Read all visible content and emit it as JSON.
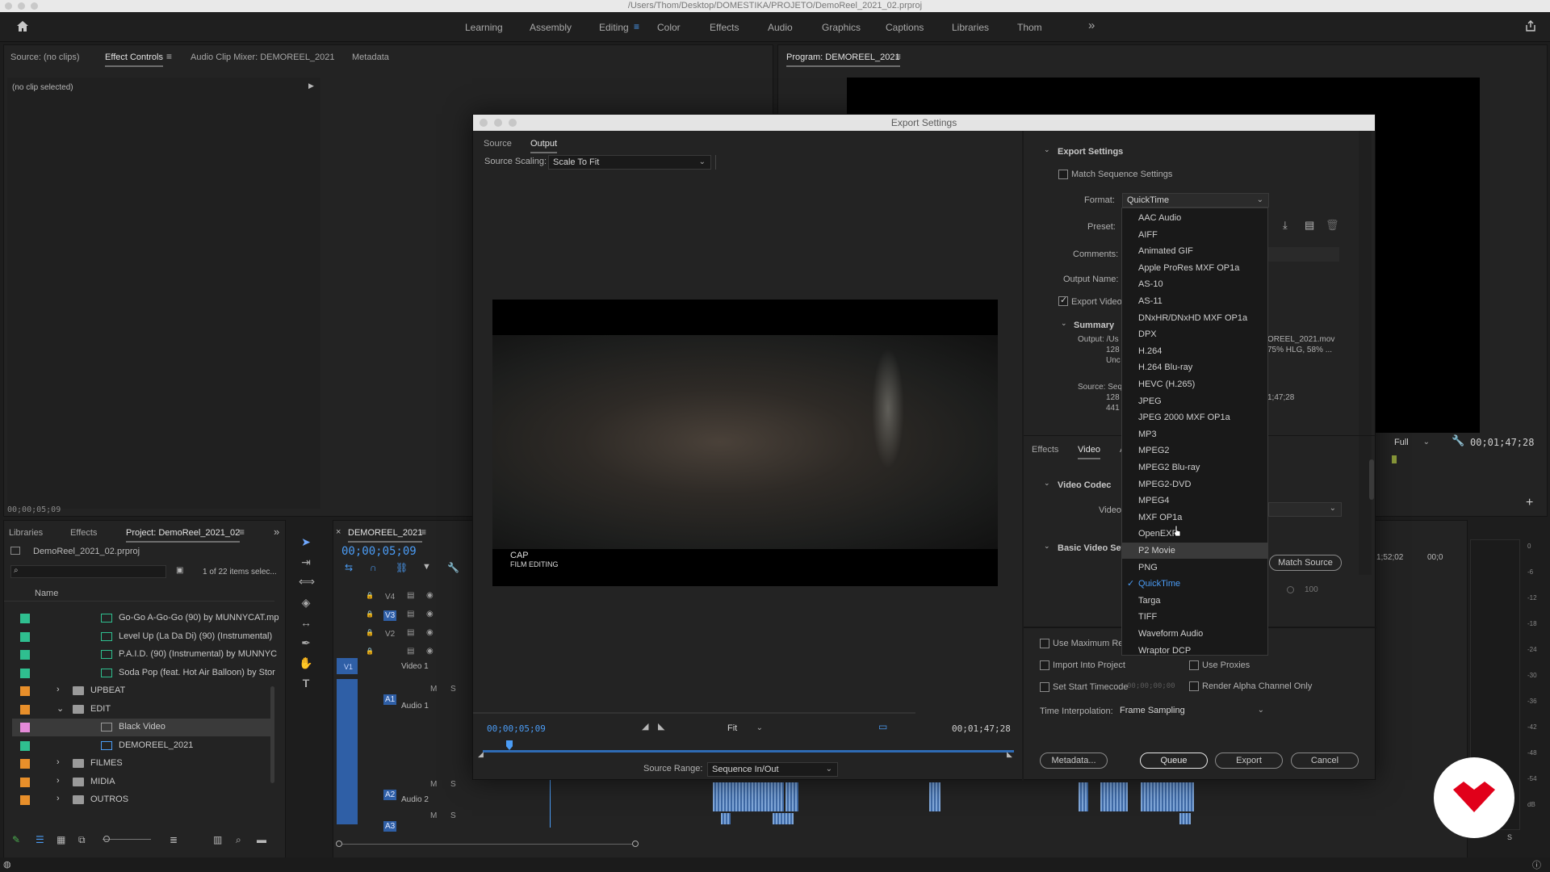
{
  "window": {
    "path": "/Users/Thom/Desktop/DOMESTIKA/PROJETO/DemoReel_2021_02.prproj"
  },
  "workspaces": [
    "Learning",
    "Assembly",
    "Editing",
    "Color",
    "Effects",
    "Audio",
    "Graphics",
    "Captions",
    "Libraries",
    "Thom"
  ],
  "workspace_overflow": "»",
  "source_panel": {
    "tabs": [
      "Source: (no clips)",
      "Effect Controls",
      "Audio Clip Mixer: DEMOREEL_2021",
      "Metadata"
    ],
    "no_clip": "(no clip selected)",
    "timecode": "00;00;05;09"
  },
  "program_panel": {
    "title": "Program: DEMOREEL_2021",
    "zoom": "Full",
    "timecode": "00;01;47;28"
  },
  "project_panel": {
    "tabs": [
      "Libraries",
      "Effects",
      "Project: DemoReel_2021_02"
    ],
    "file": "DemoReel_2021_02.prproj",
    "count": "1 of 22 items selec...",
    "column_name": "Name",
    "items": [
      {
        "name": "Go-Go A-Go-Go (90) by MUNNYCAT.mp",
        "color": "#2fbf8f",
        "kind": "audio"
      },
      {
        "name": "Level Up (La Da Di) (90) (Instrumental)",
        "color": "#2fbf8f",
        "kind": "audio"
      },
      {
        "name": "P.A.I.D. (90) (Instrumental) by MUNNYC",
        "color": "#2fbf8f",
        "kind": "audio"
      },
      {
        "name": "Soda Pop (feat. Hot Air Balloon) by Stor",
        "color": "#2fbf8f",
        "kind": "audio"
      },
      {
        "name": "UPBEAT",
        "color": "#e88f2a",
        "kind": "folder"
      },
      {
        "name": "EDIT",
        "color": "#e88f2a",
        "kind": "folder"
      },
      {
        "name": "Black Video",
        "color": "#e48ad8",
        "kind": "video"
      },
      {
        "name": "DEMOREEL_2021",
        "color": "#2fbf8f",
        "kind": "sequence"
      },
      {
        "name": "FILMES",
        "color": "#e88f2a",
        "kind": "folder"
      },
      {
        "name": "MIDIA",
        "color": "#e88f2a",
        "kind": "folder"
      },
      {
        "name": "OUTROS",
        "color": "#e88f2a",
        "kind": "folder"
      }
    ]
  },
  "timeline": {
    "sequence": "DEMOREEL_2021",
    "timecode": "00;00;05;09",
    "video_tracks": [
      "V4",
      "V3",
      "V2",
      "V1"
    ],
    "video1_label": "Video 1",
    "audio_tracks": [
      "A1",
      "A2",
      "A3"
    ],
    "audio1_label": "Audio 1",
    "audio2_label": "Audio 2",
    "ms_labels": [
      "M",
      "S"
    ],
    "ruler_times": [
      "1;52;02",
      "00;0"
    ]
  },
  "export_dialog": {
    "title": "Export Settings",
    "tabs": [
      "Source",
      "Output"
    ],
    "source_scaling_label": "Source Scaling:",
    "source_scaling_value": "Scale To Fit",
    "preview_caption_1": "CAP",
    "preview_caption_2": "FILM EDITING",
    "current_tc": "00;00;05;09",
    "fit": "Fit",
    "end_tc": "00;01;47;28",
    "source_range_label": "Source Range:",
    "source_range_value": "Sequence In/Out",
    "settings": {
      "section": "Export Settings",
      "match_sequence": "Match Sequence Settings",
      "format_label": "Format:",
      "format_value": "QuickTime",
      "preset_label": "Preset:",
      "comments_label": "Comments:",
      "output_name_label": "Output Name:",
      "export_video": "Export Video",
      "summary": "Summary",
      "output_label": "Output: /Us",
      "output_line2": "128",
      "output_line3": "Unc",
      "output_right1": "OREEL_2021.mov",
      "output_right2": "75% HLG, 58% ...",
      "source_label": "Source: Seq",
      "source_line2": "128",
      "source_line3": "441",
      "source_right": "1;47;28"
    },
    "sub_tabs": [
      "Effects",
      "Video",
      "A"
    ],
    "video_codec": "Video Codec",
    "video_label": "Video",
    "basic_video": "Basic Video Setti",
    "match_source": "Match Source",
    "slider_value": "100",
    "use_max_render": "Use Maximum Ren",
    "import_project": "Import Into Project",
    "use_proxies": "Use Proxies",
    "set_start_tc": "Set Start Timecode",
    "start_tc_value": "00;00;00;00",
    "render_alpha": "Render Alpha Channel Only",
    "time_interp_label": "Time Interpolation:",
    "time_interp_value": "Frame Sampling",
    "buttons": [
      "Metadata...",
      "Queue",
      "Export",
      "Cancel"
    ]
  },
  "format_dropdown": {
    "options": [
      "AAC Audio",
      "AIFF",
      "Animated GIF",
      "Apple ProRes MXF OP1a",
      "AS-10",
      "AS-11",
      "DNxHR/DNxHD MXF OP1a",
      "DPX",
      "H.264",
      "H.264 Blu-ray",
      "HEVC (H.265)",
      "JPEG",
      "JPEG 2000 MXF OP1a",
      "MP3",
      "MPEG2",
      "MPEG2 Blu-ray",
      "MPEG2-DVD",
      "MPEG4",
      "MXF OP1a",
      "OpenEXR",
      "P2 Movie",
      "PNG",
      "QuickTime",
      "Targa",
      "TIFF",
      "Waveform Audio",
      "Wraptor DCP"
    ],
    "selected": "QuickTime",
    "hovered": "P2 Movie"
  },
  "meter_ticks": [
    "0",
    "-6",
    "-12",
    "-18",
    "-24",
    "-30",
    "-36",
    "-42",
    "-48",
    "-54",
    "dB"
  ],
  "meter_s": "S",
  "colors": {
    "accent": "#4b9cf5",
    "folder": "#e88f2a",
    "audio": "#2fbf8f",
    "logo": "#e1001a"
  }
}
